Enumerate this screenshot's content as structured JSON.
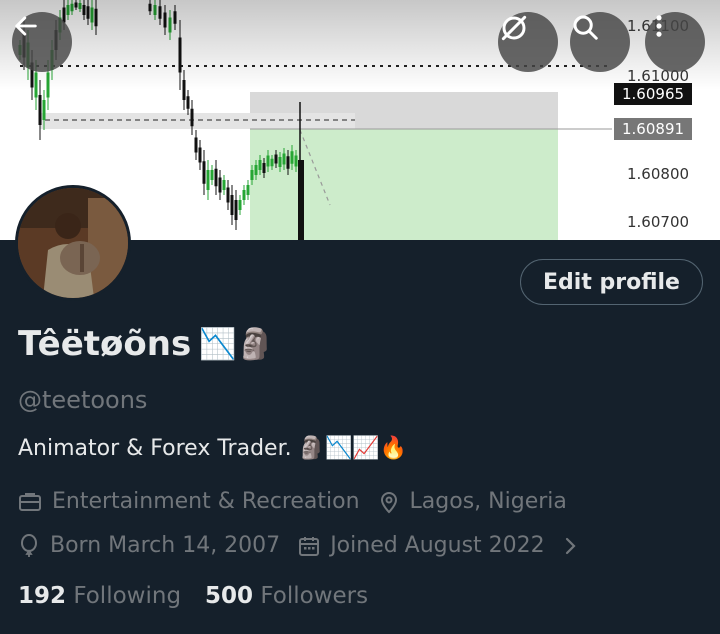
{
  "banner": {
    "prices": [
      "1.61100",
      "1.61000",
      "1.60965",
      "1.60891",
      "1.60800",
      "1.60700"
    ]
  },
  "toolbar": {
    "back_icon": "arrow-left-icon",
    "grok_icon": "slashed-circle-icon",
    "search_icon": "search-icon",
    "more_icon": "more-vertical-icon"
  },
  "profile": {
    "edit_label": "Edit profile",
    "display_name": "Têëtøõns",
    "name_emojis": "📉🗿",
    "handle": "@teetoons",
    "bio_text": "Animator & Forex Trader.",
    "bio_emojis": "🗿📉📈🔥",
    "category": "Entertainment & Recreation",
    "location": "Lagos, Nigeria",
    "birthday": "Born March 14, 2007",
    "joined": "Joined August 2022",
    "following_count": "192",
    "following_label": "Following",
    "followers_count": "500",
    "followers_label": "Followers"
  },
  "colors": {
    "background": "#15202b",
    "text_primary": "#e7e9ea",
    "text_secondary": "#71767b",
    "candle_up": "#26a634",
    "candle_down": "#111111",
    "profit_zone": "#cdeccb"
  }
}
